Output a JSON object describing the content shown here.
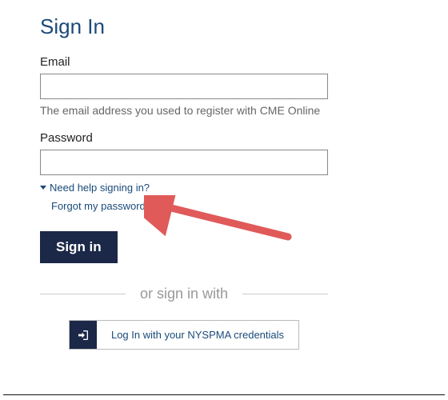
{
  "title": "Sign In",
  "email": {
    "label": "Email",
    "value": "",
    "hint": "The email address you used to register with CME Online"
  },
  "password": {
    "label": "Password",
    "value": ""
  },
  "help": {
    "toggle_label": "Need help signing in?",
    "forgot_label": "Forgot my password"
  },
  "signin_label": "Sign in",
  "divider": {
    "text": "or sign in with"
  },
  "idp": {
    "label": "Log In with your NYSPMA credentials",
    "icon_name": "login-idp-icon"
  },
  "colors": {
    "brand_text": "#1a4a7a",
    "button_bg": "#1b2847",
    "arrow": "#e05a5a"
  }
}
